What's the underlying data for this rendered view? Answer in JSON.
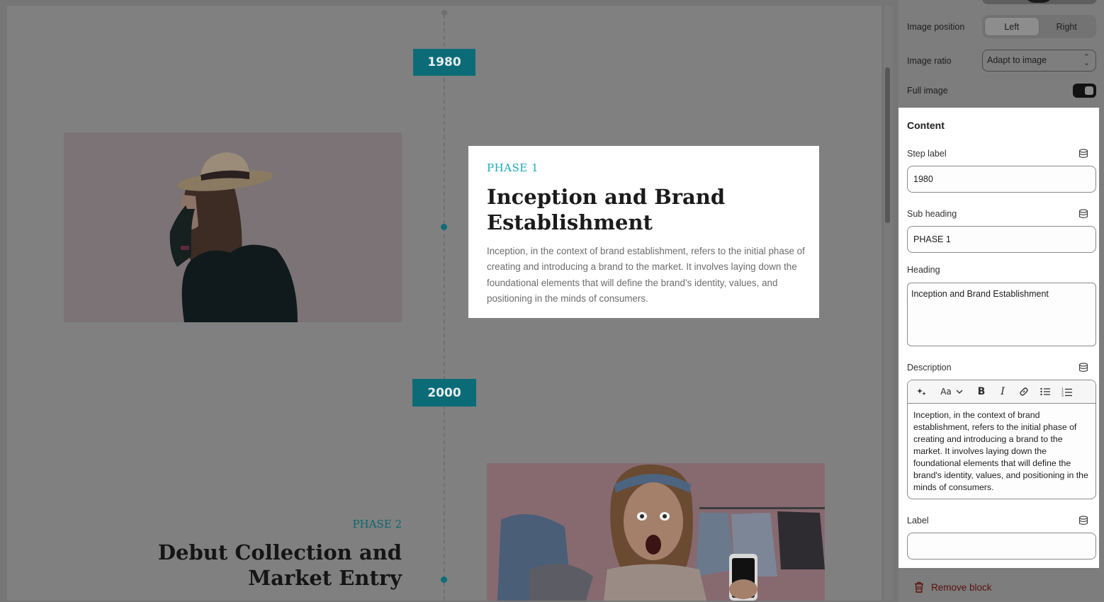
{
  "preview": {
    "timeline": [
      {
        "year": "1980",
        "phase": "PHASE 1",
        "heading": "Inception and Brand Establishment",
        "description": "Inception, in the context of brand establishment, refers to the initial phase of creating and introducing a brand to the market. It involves laying down the foundational elements that will define the brand’s identity, values, and positioning in the minds of consumers."
      },
      {
        "year": "2000",
        "phase": "PHASE 2",
        "heading": "Debut Collection and Market Entry"
      }
    ],
    "colors": {
      "accent": "#1aa9b8",
      "badge": "#0b6c78"
    }
  },
  "settings": {
    "image_position": {
      "label": "Image position",
      "options": [
        "Left",
        "Right"
      ],
      "selected": "Left"
    },
    "image_ratio": {
      "label": "Image ratio",
      "value": "Adapt to image"
    },
    "full_image": {
      "label": "Full image",
      "on": true
    },
    "content": {
      "title": "Content",
      "step_label": {
        "label": "Step label",
        "value": "1980"
      },
      "sub_heading": {
        "label": "Sub heading",
        "value": "PHASE 1"
      },
      "heading": {
        "label": "Heading",
        "value": "Inception and Brand Establishment"
      },
      "description": {
        "label": "Description",
        "toolbar": {
          "font_button": "Aa"
        },
        "value": "Inception, in the context of brand establishment, refers to the initial phase of creating and introducing a brand to the market. It involves laying down the foundational elements that will define the brand's identity, values, and positioning in the minds of consumers."
      },
      "label_field": {
        "label": "Label",
        "value": ""
      }
    },
    "remove_block": "Remove block"
  }
}
